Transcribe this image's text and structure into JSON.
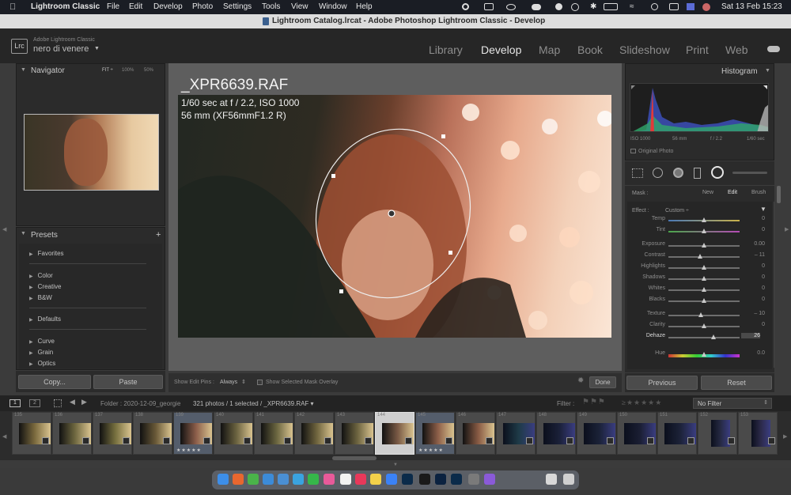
{
  "menubar": {
    "apple": "",
    "app_name": "Lightroom Classic",
    "items": [
      "File",
      "Edit",
      "Develop",
      "Photo",
      "Settings",
      "Tools",
      "View",
      "Window",
      "Help"
    ],
    "clock": "Sat 13 Feb  15:23"
  },
  "window": {
    "title": "Lightroom Catalog.lrcat - Adobe Photoshop Lightroom Classic - Develop"
  },
  "identity": {
    "logo": "Lrc",
    "brand": "Adobe Lightroom Classic",
    "user": "nero di venere"
  },
  "modules": [
    "Library",
    "Develop",
    "Map",
    "Book",
    "Slideshow",
    "Print",
    "Web"
  ],
  "active_module": "Develop",
  "navigator": {
    "title": "Navigator",
    "zoom_options": [
      "FIT ÷",
      "100%",
      "50%"
    ]
  },
  "presets": {
    "title": "Presets",
    "add": "+",
    "groups": [
      [
        "Favorites"
      ],
      [
        "Color",
        "Creative",
        "B&W"
      ],
      [
        "Defaults"
      ],
      [
        "Curve",
        "Grain",
        "Optics"
      ]
    ]
  },
  "left_buttons": {
    "copy": "Copy...",
    "paste": "Paste"
  },
  "image": {
    "filename": "_XPR6639.RAF",
    "exposure": "1/60 sec at f / 2.2, ISO 1000",
    "lens": "56 mm (XF56mmF1.2 R)"
  },
  "toolbar": {
    "pins_label": "Show Edit Pins :",
    "pins_value": "Always",
    "overlay_label": "Show Selected Mask Overlay",
    "done": "Done"
  },
  "histogram": {
    "title": "Histogram",
    "readouts": [
      "ISO 1000",
      "56 mm",
      "f / 2.2",
      "1/60 sec"
    ],
    "original_photo": "Original Photo"
  },
  "mask": {
    "label": "Mask :",
    "modes": [
      "New",
      "Edit",
      "Brush"
    ],
    "active_mode": "Edit",
    "effect_label": "Effect :",
    "effect_value": "Custom ÷"
  },
  "sliders": [
    {
      "label": "Temp",
      "value": "0",
      "pos": 0.5
    },
    {
      "label": "Tint",
      "value": "0",
      "pos": 0.5
    },
    {
      "label": "Exposure",
      "value": "0.00",
      "pos": 0.5
    },
    {
      "label": "Contrast",
      "value": "– 11",
      "pos": 0.44
    },
    {
      "label": "Highlights",
      "value": "0",
      "pos": 0.5
    },
    {
      "label": "Shadows",
      "value": "0",
      "pos": 0.5
    },
    {
      "label": "Whites",
      "value": "0",
      "pos": 0.5
    },
    {
      "label": "Blacks",
      "value": "0",
      "pos": 0.5
    },
    {
      "label": "Texture",
      "value": "– 10",
      "pos": 0.45
    },
    {
      "label": "Clarity",
      "value": "0",
      "pos": 0.5
    },
    {
      "label": "Dehaze",
      "value": "26",
      "pos": 0.63
    },
    {
      "label": "Hue",
      "value": "0.0",
      "pos": 0.5
    }
  ],
  "right_buttons": {
    "previous": "Previous",
    "reset": "Reset"
  },
  "filmstrip_bar": {
    "screens": [
      "1",
      "2"
    ],
    "folder": "Folder : 2020-12-09_georgie",
    "count": "321 photos / 1 selected / _XPR6639.RAF ▾",
    "filter_label": "Filter :",
    "filter_value": "No Filter"
  },
  "thumbs": [
    {
      "num": "135",
      "tone": "#7b6a3e",
      "stars": ""
    },
    {
      "num": "136",
      "tone": "#6f6840",
      "stars": ""
    },
    {
      "num": "137",
      "tone": "#77703f",
      "stars": ""
    },
    {
      "num": "138",
      "tone": "#6a5a38",
      "stars": ""
    },
    {
      "num": "139",
      "tone": "#8c5e4a",
      "stars": "★★★★★"
    },
    {
      "num": "140",
      "tone": "#6b6340",
      "stars": ""
    },
    {
      "num": "141",
      "tone": "#6b6640",
      "stars": ""
    },
    {
      "num": "142",
      "tone": "#71663f",
      "stars": ""
    },
    {
      "num": "143",
      "tone": "#6d6440",
      "stars": ""
    },
    {
      "num": "144",
      "tone": "#7a5a45",
      "stars": ""
    },
    {
      "num": "145",
      "tone": "#8e6049",
      "stars": "★★★★★"
    },
    {
      "num": "146",
      "tone": "#8a5c45",
      "stars": ""
    },
    {
      "num": "147",
      "tone": "#1e3b48",
      "stars": ""
    },
    {
      "num": "148",
      "tone": "#1a2038",
      "stars": ""
    },
    {
      "num": "149",
      "tone": "#1b2238",
      "stars": ""
    },
    {
      "num": "150",
      "tone": "#1a1e33",
      "stars": ""
    },
    {
      "num": "151",
      "tone": "#1c2238",
      "stars": ""
    },
    {
      "num": "152",
      "tone": "#262a44",
      "stars": ""
    },
    {
      "num": "153",
      "tone": "#2c2a4a",
      "stars": ""
    }
  ],
  "colors": {
    "menubar": "#1a1d24",
    "panel": "#2b2b2b",
    "canvas": "#5e5e5e",
    "active_thumb": "#cfcfcf"
  }
}
